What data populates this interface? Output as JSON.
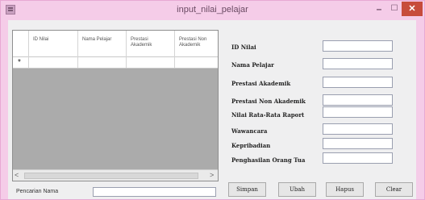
{
  "window": {
    "title": "input_nilai_pelajar",
    "min_glyph": "–",
    "max_glyph": "☐",
    "close_glyph": "✕"
  },
  "grid": {
    "columns": [
      "ID Nilai",
      "Nama Pelajar",
      "Prestasi\nAkademik",
      "Prestasi Non\nAkademik"
    ],
    "new_row_marker": "*",
    "scroll_left": "<",
    "scroll_right": ">"
  },
  "search": {
    "label": "Pencarian Nama",
    "value": ""
  },
  "form": {
    "fields": [
      {
        "label": "ID Nilai",
        "value": ""
      },
      {
        "label": "Nama Pelajar",
        "value": ""
      },
      {
        "label": "Prestasi Akademik",
        "value": ""
      },
      {
        "label": "Prestasi Non Akademik",
        "value": ""
      },
      {
        "label": " Nilai Rata-Rata Raport",
        "value": ""
      },
      {
        "label": "Wawancara",
        "value": ""
      },
      {
        "label": "Kepribadian",
        "value": ""
      },
      {
        "label": "Penghasilan Orang Tua",
        "value": ""
      }
    ]
  },
  "buttons": {
    "simpan": "Simpan",
    "ubah": "Ubah",
    "hapus": "Hapus",
    "clear": "Clear"
  }
}
